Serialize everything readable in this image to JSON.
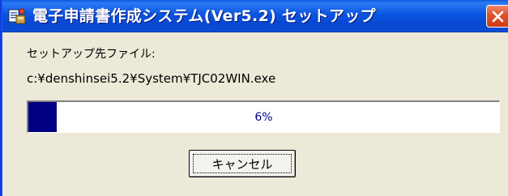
{
  "window": {
    "title": "電子申請書作成システム(Ver5.2) セットアップ",
    "icon": "setup-app-icon",
    "close_icon": "close-icon"
  },
  "content": {
    "destination_label": "セットアップ先ファイル:",
    "file_path": "c:¥denshinsei5.2¥System¥TJC02WIN.exe"
  },
  "progress": {
    "percent": 6,
    "label": "6%"
  },
  "buttons": {
    "cancel_label": "キャンセル"
  },
  "colors": {
    "titlebar": "#0a55e0",
    "progress_fill": "#000080",
    "close_button": "#e0552e",
    "dialog_bg": "#ece9d8"
  }
}
